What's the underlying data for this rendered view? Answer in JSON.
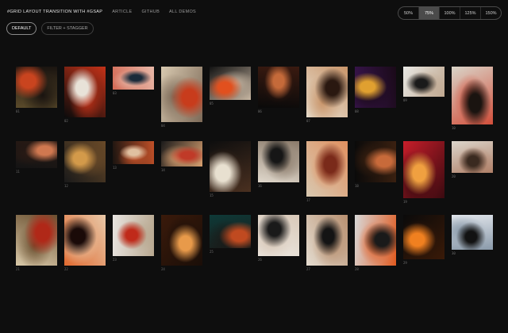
{
  "header": {
    "title": "#GRID LAYOUT TRANSITION WITH #GSAP",
    "links": [
      "ARTICLE",
      "GITHUB",
      "ALL DEMOS"
    ]
  },
  "zoom": {
    "options": [
      "50%",
      "75%",
      "100%",
      "125%",
      "150%"
    ],
    "selected": "75%"
  },
  "modes": {
    "options": [
      "DEFAULT",
      "FILTER + STAGGER"
    ],
    "selected": "DEFAULT"
  },
  "items": [
    {
      "num": "01",
      "c": [
        "#5a4a2a",
        "#c9441f",
        "#1a1410"
      ]
    },
    {
      "num": "02",
      "c": [
        "#0b0b0b",
        "#e8e2d8",
        "#c43218"
      ]
    },
    {
      "num": "03",
      "c": [
        "#d36a55",
        "#1a2a3a",
        "#e8b8a8"
      ]
    },
    {
      "num": "04",
      "c": [
        "#d8c9b0",
        "#c83c1c",
        "#7d6a58"
      ]
    },
    {
      "num": "05",
      "c": [
        "#121212",
        "#e2501e",
        "#c7b6a2"
      ]
    },
    {
      "num": "06",
      "c": [
        "#0a0a0a",
        "#c56a3a",
        "#3a1a10"
      ]
    },
    {
      "num": "07",
      "c": [
        "#e9e2d4",
        "#2a1810",
        "#c9956a"
      ]
    },
    {
      "num": "08",
      "c": [
        "#3a1550",
        "#e0a030",
        "#1a0a18"
      ]
    },
    {
      "num": "09",
      "c": [
        "#e8e8e4",
        "#1a1a1a",
        "#c0a890"
      ]
    },
    {
      "num": "10",
      "c": [
        "#d9d4c8",
        "#1a1410",
        "#d24e3a"
      ]
    },
    {
      "num": "11",
      "c": [
        "#141414",
        "#d07850",
        "#2a1a14"
      ]
    },
    {
      "num": "12",
      "c": [
        "#1a1a1a",
        "#d39a4a",
        "#6a4a28"
      ]
    },
    {
      "num": "13",
      "c": [
        "#1a1410",
        "#e0c0a0",
        "#c05028"
      ]
    },
    {
      "num": "14",
      "c": [
        "#1a1a1a",
        "#c03a28",
        "#d8a070"
      ]
    },
    {
      "num": "15",
      "c": [
        "#0e0e0e",
        "#e8e0d0",
        "#4a3020"
      ]
    },
    {
      "num": "16",
      "c": [
        "#e0d8cc",
        "#161616",
        "#8a7a6a"
      ]
    },
    {
      "num": "17",
      "c": [
        "#d8c8b0",
        "#7a2a1a",
        "#e09060"
      ]
    },
    {
      "num": "18",
      "c": [
        "#0a0a0a",
        "#c86a3a",
        "#3a2010"
      ]
    },
    {
      "num": "19",
      "c": [
        "#c81e2a",
        "#f0a040",
        "#3a0a10"
      ]
    },
    {
      "num": "20",
      "c": [
        "#dcd6cc",
        "#3a2a20",
        "#b08068"
      ]
    },
    {
      "num": "21",
      "c": [
        "#d8c8a8",
        "#b02818",
        "#6a5030"
      ]
    },
    {
      "num": "22",
      "c": [
        "#e06a30",
        "#1a0a08",
        "#e8c8a8"
      ]
    },
    {
      "num": "23",
      "c": [
        "#e8e4e0",
        "#c02a1a",
        "#b8a890"
      ]
    },
    {
      "num": "24",
      "c": [
        "#3a1a0a",
        "#e89a4a",
        "#1a0e08"
      ]
    },
    {
      "num": "25",
      "c": [
        "#0e3a38",
        "#c04a20",
        "#1a1a18"
      ]
    },
    {
      "num": "26",
      "c": [
        "#eeeae4",
        "#1a1a1a",
        "#d8c8b8"
      ]
    },
    {
      "num": "27",
      "c": [
        "#e4dcd0",
        "#141414",
        "#b89070"
      ]
    },
    {
      "num": "28",
      "c": [
        "#d8d8d8",
        "#1a1a1a",
        "#e05a20"
      ]
    },
    {
      "num": "29",
      "c": [
        "#0a0a0a",
        "#f08020",
        "#3a1a08"
      ]
    },
    {
      "num": "30",
      "c": [
        "#e0e4ea",
        "#121212",
        "#8a9aaa"
      ]
    }
  ]
}
